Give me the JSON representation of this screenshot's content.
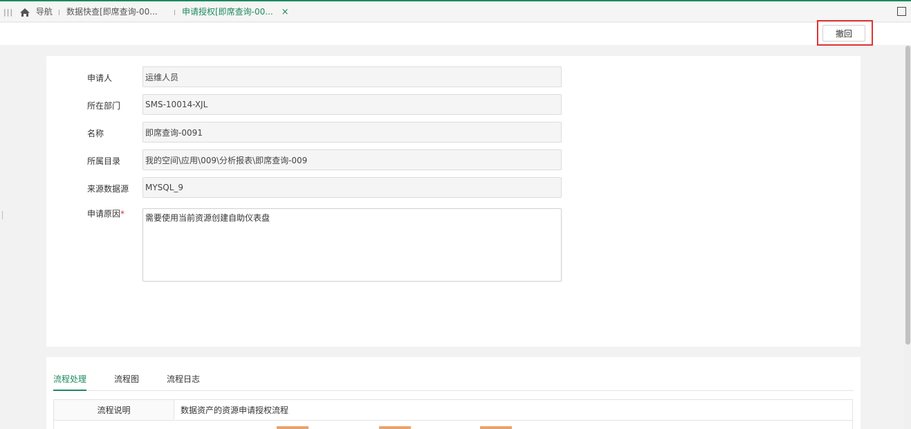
{
  "tabs": {
    "menu_glyph": "|||",
    "nav_label": "导航",
    "tab1_label": "数据快查[即席查询-00...",
    "tab2_label": "申请授权[即席查询-00...",
    "close_glyph": "×"
  },
  "toolbar": {
    "withdraw_label": "撤回"
  },
  "form": {
    "applicant_label": "申请人",
    "applicant_value": "运维人员",
    "department_label": "所在部门",
    "department_value": "SMS-10014-XJL",
    "name_label": "名称",
    "name_value": "即席查询-0091",
    "directory_label": "所属目录",
    "directory_value": "我的空间\\应用\\009\\分析报表\\即席查询-009",
    "datasource_label": "来源数据源",
    "datasource_value": "MYSQL_9",
    "reason_label": "申请原因",
    "reason_required": "*",
    "reason_value": "需要使用当前资源创建自助仪表盘"
  },
  "process": {
    "tabs": [
      "流程处理",
      "流程图",
      "流程日志"
    ],
    "desc_label": "流程说明",
    "desc_value": "数据资产的资源申请授权流程"
  },
  "colors": {
    "accent": "#1b8a5e",
    "highlight": "#e03131"
  }
}
